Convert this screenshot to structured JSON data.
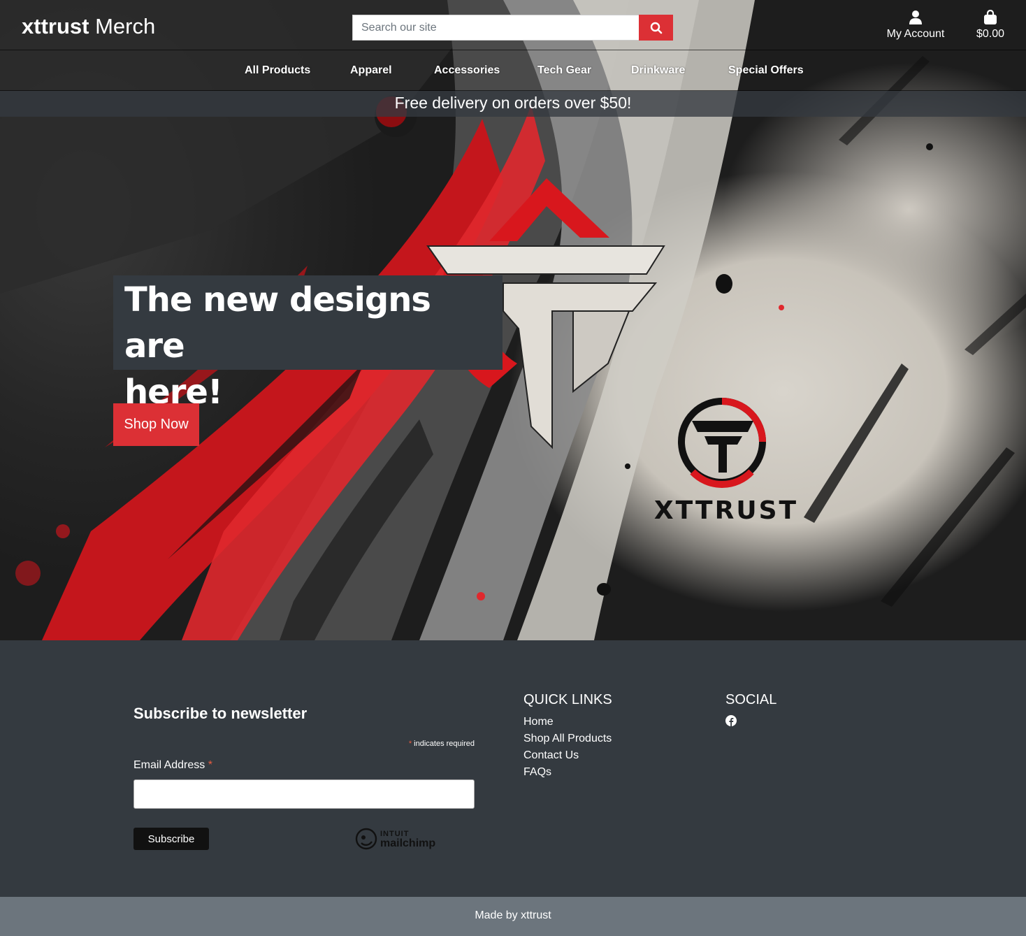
{
  "header": {
    "brand_bold": "xttrust",
    "brand_light": "Merch",
    "search_placeholder": "Search our site",
    "account_label": "My Account",
    "cart_total": "$0.00"
  },
  "nav": {
    "items": [
      "All Products",
      "Apparel",
      "Accessories",
      "Tech Gear",
      "Drinkware",
      "Special Offers"
    ]
  },
  "promo": {
    "text": "Free delivery on orders over $50!"
  },
  "hero": {
    "title_line1": "The new designs are",
    "title_line2": "here!",
    "cta_label": "Shop Now",
    "logo_wordmark": "XTTRUST"
  },
  "newsletter": {
    "title": "Subscribe to newsletter",
    "required_star": "*",
    "required_note": "indicates required",
    "email_label": "Email Address",
    "email_value": "",
    "subscribe_label": "Subscribe",
    "badge_line1": "INTUIT",
    "badge_line2": "mailchimp"
  },
  "quick_links": {
    "title": "QUICK LINKS",
    "items": [
      "Home",
      "Shop All Products",
      "Contact Us",
      "FAQs"
    ]
  },
  "social": {
    "title": "SOCIAL",
    "icons": [
      "facebook-icon"
    ]
  },
  "footer_bottom": {
    "text": "Made by xttrust"
  },
  "colors": {
    "accent_red": "#dc3035",
    "footer_dark": "#343a40",
    "footer_bar": "#6c757d"
  }
}
